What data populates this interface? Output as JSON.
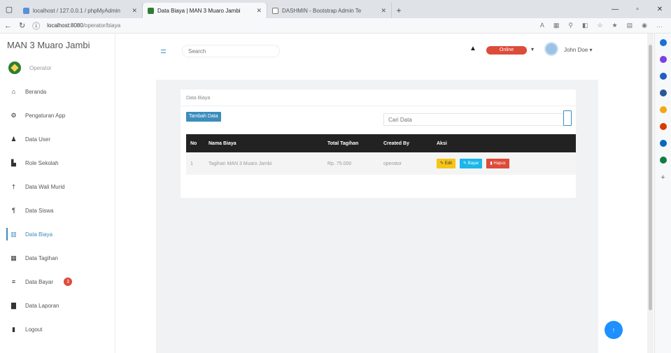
{
  "browser": {
    "tabs": [
      {
        "title": "localhost / 127.0.0.1 / phpMyAdmin"
      },
      {
        "title": "Data Biaya | MAN 3 Muaro Jambi"
      },
      {
        "title": "DASHMIN - Bootstrap Admin Te"
      }
    ],
    "url_host": "localhost:8080",
    "url_path": "/operator/biaya"
  },
  "app": {
    "brand": "MAN 3 Muaro Jambi",
    "role": "Operator",
    "search_placeholder": "Search",
    "status_pill": "Online",
    "user_name": "John Doe"
  },
  "sidebar": {
    "items": [
      {
        "label": "Beranda",
        "icon": "home-icon"
      },
      {
        "label": "Pengaturan App",
        "icon": "gear-icon"
      },
      {
        "label": "Data User",
        "icon": "user-icon"
      },
      {
        "label": "Role Sekolah",
        "icon": "building-icon"
      },
      {
        "label": "Data Wali Murid",
        "icon": "person-icon"
      },
      {
        "label": "Data Siswa",
        "icon": "student-icon"
      },
      {
        "label": "Data Biaya",
        "icon": "chart-icon"
      },
      {
        "label": "Data Tagihan",
        "icon": "table-icon"
      },
      {
        "label": "Data Bayar",
        "icon": "list-icon",
        "badge": "3"
      },
      {
        "label": "Data Laporan",
        "icon": "doc-icon"
      },
      {
        "label": "Logout",
        "icon": "logout-icon"
      }
    ]
  },
  "main": {
    "card_title": "Data Biaya",
    "add_button": "Tambah Data",
    "search_placeholder": "Cari Data",
    "table": {
      "headers": [
        "No",
        "Nama Biaya",
        "Total Tagihan",
        "Created By",
        "Aksi"
      ],
      "rows": [
        {
          "no": "1",
          "nama": "Tagihan MAN 3 Muaro Jambi",
          "total": "Rp. 75.000",
          "created_by": "operator"
        }
      ],
      "actions": {
        "edit": "Edit",
        "bayar": "Bayar",
        "hapus": "Hapus"
      }
    }
  },
  "colors": {
    "accent": "#3c8dbc",
    "danger": "#dd4b39",
    "warning": "#f5c518",
    "info": "#1ab7ea"
  }
}
